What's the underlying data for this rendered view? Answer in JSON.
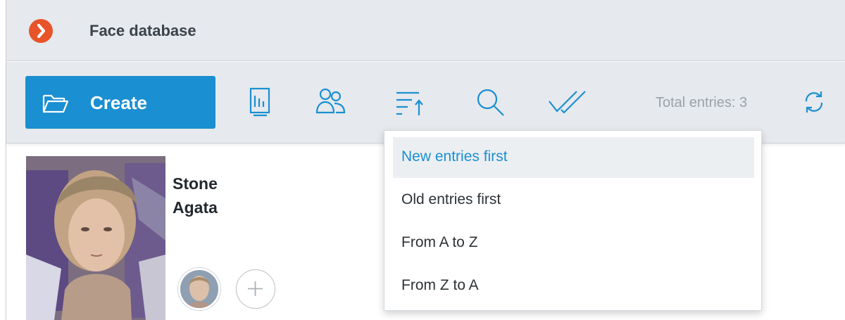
{
  "app": {
    "title": "Face database",
    "logo_icon": "chevron-right-circle-icon",
    "logo_color": "#e8542a"
  },
  "toolbar": {
    "create_label": "Create",
    "create_icon": "folder-icon",
    "accent": "#1a8fd1",
    "icons": [
      "report-icon",
      "users-icon",
      "sort-icon",
      "search-icon",
      "check-all-icon"
    ],
    "total_label": "Total entries: 3",
    "refresh_icon": "refresh-icon"
  },
  "card": {
    "last_name": "Stone",
    "first_name": "Agata",
    "add_icon": "plus-icon"
  },
  "sort_menu": {
    "items": [
      {
        "label": "New entries first",
        "selected": true
      },
      {
        "label": "Old entries first",
        "selected": false
      },
      {
        "label": "From A to Z",
        "selected": false
      },
      {
        "label": "From Z to A",
        "selected": false
      }
    ]
  }
}
